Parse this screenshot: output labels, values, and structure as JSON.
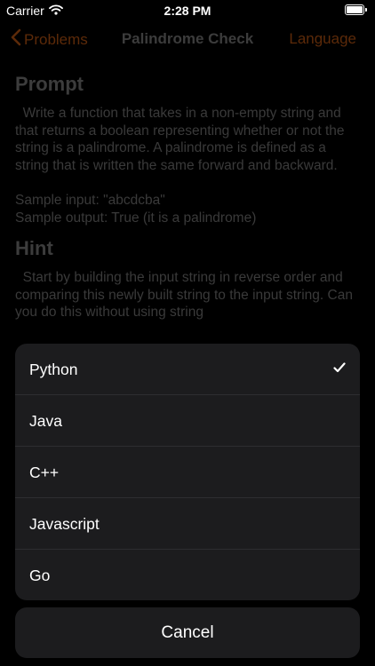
{
  "status_bar": {
    "carrier": "Carrier",
    "time": "2:28 PM"
  },
  "navbar": {
    "back_label": "Problems",
    "title": "Palindrome Check",
    "right_label": "Language"
  },
  "prompt": {
    "title": "Prompt",
    "body": "  Write a function that takes in a non-empty string and that returns a boolean representing whether or not the string is a palindrome. A palindrome is defined as a string that is written the same forward and backward.",
    "sample_input": "Sample input: \"abcdcba\"",
    "sample_output": "Sample output: True (it is a palindrome)"
  },
  "hint": {
    "title": "Hint",
    "body": "  Start by building the input string in reverse order and comparing this newly built string to the input string. Can you do this without using string"
  },
  "action_sheet": {
    "options": [
      {
        "label": "Python",
        "selected": true
      },
      {
        "label": "Java"
      },
      {
        "label": "C++"
      },
      {
        "label": "Javascript"
      },
      {
        "label": "Go"
      }
    ],
    "cancel_label": "Cancel"
  },
  "colors": {
    "accent_dimmed": "#5c2a09",
    "sheet_background": "#1c1c1e",
    "background": "#000000"
  }
}
